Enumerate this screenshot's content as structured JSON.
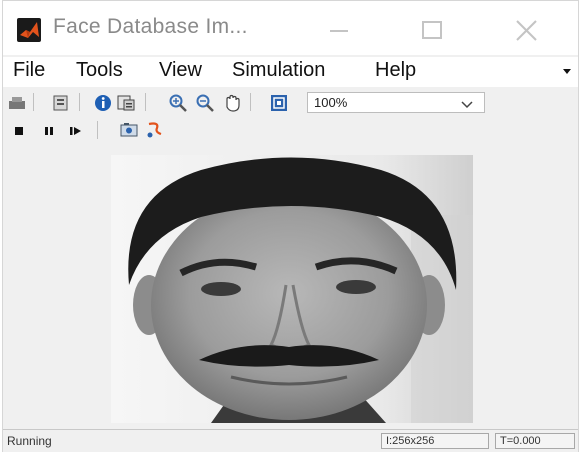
{
  "window": {
    "title": "Face Database Im..."
  },
  "menu": {
    "items": [
      "File",
      "Tools",
      "View",
      "Simulation",
      "Help"
    ]
  },
  "toolbar": {
    "zoom_value": "100%"
  },
  "status": {
    "state": "Running",
    "dimensions": "I:256x256",
    "time": "T=0.000"
  },
  "colors": {
    "window_bg": "#f0f0f0",
    "titlebar_bg": "#ffffff",
    "matlab_icon": "#e2531c",
    "info_icon": "#1e5fb4"
  }
}
